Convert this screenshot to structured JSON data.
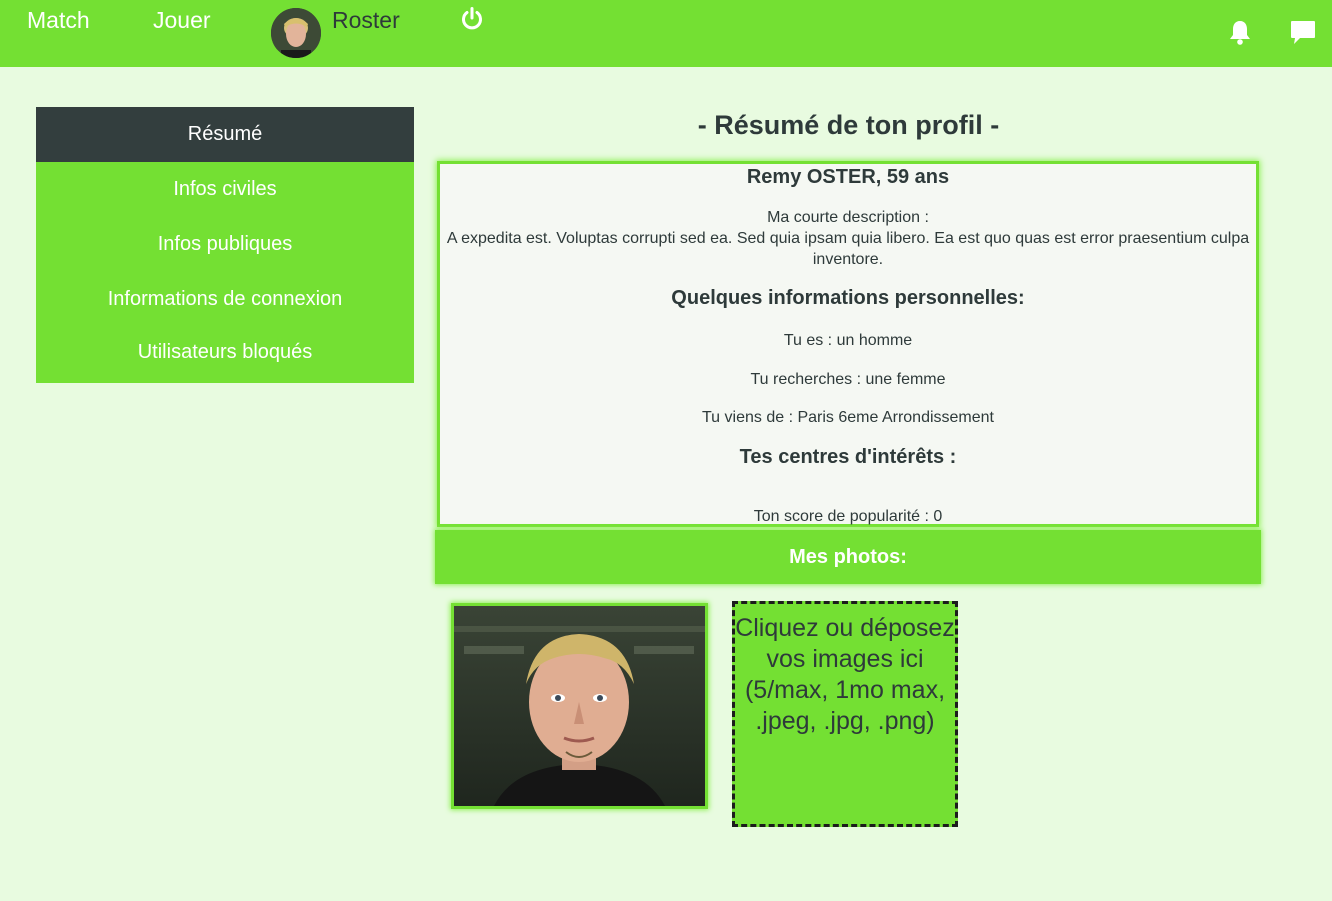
{
  "navbar": {
    "links": [
      "Match",
      "Jouer"
    ],
    "user_name": "Roster",
    "icons": [
      "power-icon",
      "bell-icon",
      "chat-icon"
    ],
    "color": "#74e033"
  },
  "sidebar": {
    "items": [
      {
        "label": "Résumé",
        "active": true
      },
      {
        "label": "Infos civiles",
        "active": false
      },
      {
        "label": "Infos publiques",
        "active": false
      },
      {
        "label": "Informations de connexion",
        "active": false
      },
      {
        "label": "Utilisateurs bloqués",
        "active": false
      }
    ],
    "active_color": "#333e3e"
  },
  "main": {
    "title": "- Résumé de ton profil -",
    "profile": {
      "name": "Remy OSTER, 59 ans",
      "desc_label": "Ma courte description :",
      "desc_text": "A expedita est. Voluptas corrupti sed ea. Sed quia ipsam quia libero. Ea est quo quas est error praesentium culpa inventore.",
      "personal_heading": "Quelques informations personnelles:",
      "gender": "Tu es : un homme",
      "seeking": "Tu recherches : une femme",
      "location": "Tu viens de : Paris 6eme Arrondissement",
      "interests_heading": "Tes centres d'intérêts :",
      "popularity": "Ton score de popularité : 0"
    },
    "photos_heading": "Mes photos:",
    "dropzone_text": "Cliquez ou déposez vos images ici (5/max, 1mo max, .jpeg, .jpg, .png)"
  }
}
